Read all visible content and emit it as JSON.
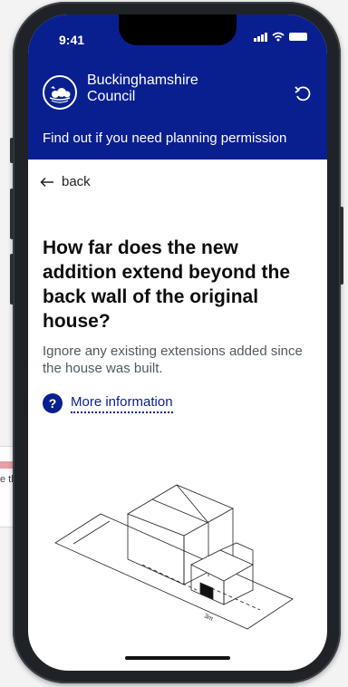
{
  "background": {
    "partial_text": "e th"
  },
  "status_bar": {
    "time": "9:41"
  },
  "header": {
    "brand_line1": "Buckinghamshire",
    "brand_line2": "Council",
    "subtitle": "Find out if you need planning permission",
    "color": "#0a1f8f"
  },
  "nav": {
    "back_label": "back"
  },
  "question": {
    "title": "How far does the new addition extend beyond the back wall of the original house?",
    "hint": "Ignore any existing extensions added since the house was built.",
    "more_info_label": "More information",
    "more_info_icon": "?"
  },
  "illustration": {
    "dimension_label": "3m"
  }
}
